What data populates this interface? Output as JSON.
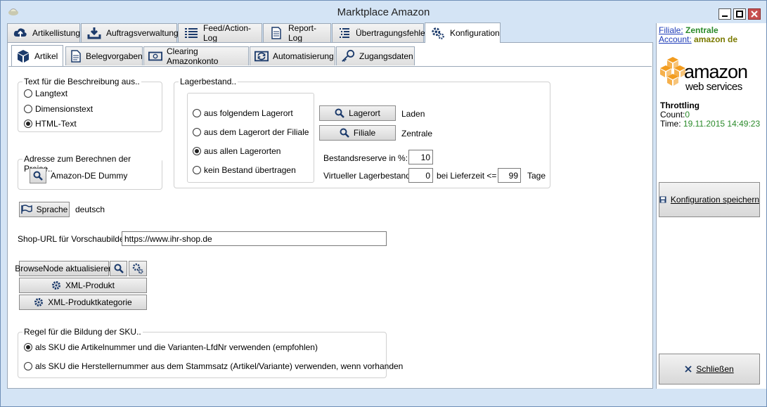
{
  "window": {
    "title": "Marktplace Amazon"
  },
  "tabs": [
    {
      "label": "Artikellistung",
      "icon": "cloud-upload-icon"
    },
    {
      "label": "Auftragsverwaltung",
      "icon": "download-tray-icon"
    },
    {
      "label": "Feed/Action-Log",
      "icon": "list-icon"
    },
    {
      "label": "Report-Log",
      "icon": "document-icon"
    },
    {
      "label": "Übertragungsfehler",
      "icon": "error-list-icon"
    },
    {
      "label": "Konfiguration",
      "icon": "gears-icon",
      "active": true
    }
  ],
  "subtabs": [
    {
      "label": "Artikel",
      "icon": "cube-icon",
      "active": true
    },
    {
      "label": "Belegvorgaben",
      "icon": "receipt-icon"
    },
    {
      "label": "Clearing Amazonkonto",
      "icon": "money-icon"
    },
    {
      "label": "Automatisierung",
      "icon": "sync-icon"
    },
    {
      "label": "Zugangsdaten",
      "icon": "key-icon"
    }
  ],
  "text_group": {
    "title": "Text für die Beschreibung aus..",
    "options": [
      "Langtext",
      "Dimensionstext",
      "HTML-Text"
    ],
    "selected": 2
  },
  "address_group": {
    "title": "Adresse zum Berechnen der Preise..",
    "value": "Amazon-DE Dummy"
  },
  "stock_group": {
    "title": "Lagerbestand..",
    "options": [
      "aus folgendem Lagerort",
      "aus dem Lagerort der Filiale",
      "aus allen Lagerorten",
      "kein Bestand übertragen"
    ],
    "selected": 2,
    "lagerort_button": "Lagerort",
    "lagerort_value": "Laden",
    "filiale_button": "Filiale",
    "filiale_value": "Zentrale",
    "reserve_label": "Bestandsreserve in %:",
    "reserve_value": "10",
    "virtual_label": "Virtueller Lagerbestand:",
    "virtual_value": "0",
    "lieferzeit_label": "bei Lieferzeit <=",
    "lieferzeit_value": "99",
    "tage_label": "Tage"
  },
  "language": {
    "button": "Sprache",
    "value": "deutsch"
  },
  "shop_url": {
    "label": "Shop-URL für Vorschaubilder:",
    "value": "https://www.ihr-shop.de"
  },
  "browse": {
    "update_button": "BrowseNode aktualisieren",
    "xml_product": "XML-Produkt",
    "xml_category": "XML-Produktkategorie"
  },
  "sku_group": {
    "title": "Regel für die Bildung der SKU..",
    "options": [
      "als SKU die Artikelnummer und die Varianten-LfdNr verwenden (empfohlen)",
      "als SKU die Herstellernummer aus dem Stammsatz (Artikel/Variante) verwenden, wenn vorhanden"
    ],
    "selected": 0
  },
  "sidebar": {
    "filiale_label": "Filiale:",
    "filiale_value": "Zentrale",
    "account_label": "Account:",
    "account_value": "amazon de",
    "logo_word": "amazon",
    "logo_sub": "web services",
    "throttling_title": "Throttling",
    "count_label": "Count:",
    "count_value": "0",
    "time_label": "Time:",
    "time_value": "19.11.2015 14:49:23",
    "save_button": "Konfiguration speichern",
    "close_button": "Schließen"
  },
  "colors": {
    "accent_green": "#2a8a2a",
    "account_olive": "#7a7a00",
    "logo_orange": "#f29c1f"
  }
}
